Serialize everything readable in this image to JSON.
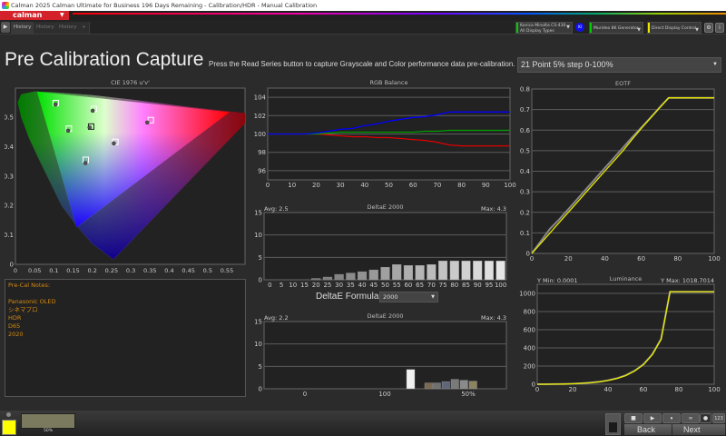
{
  "window": {
    "title": "Calman 2025 Calman Ultimate for Business 196 Days Remaining  - Calibration/HDR - Manual Calibration"
  },
  "logo": {
    "text": "calman"
  },
  "tabs": [
    {
      "label": "History 1",
      "active": true
    },
    {
      "label": "History 2"
    },
    {
      "label": "History 3"
    },
    {
      "label": "+"
    }
  ],
  "devices": {
    "meter": {
      "line1": "Konica Minolta CS-430",
      "line2": "All Display Types",
      "badge": "KI",
      "color": "#00cc00"
    },
    "generator": {
      "line1": "Murideo 8K Generator",
      "color": "#00cc00"
    },
    "display": {
      "line1": "Direct Display Control",
      "color": "#e8e800"
    }
  },
  "page": {
    "title": "Pre Calibration Capture",
    "instructions": "Press the Read Series button to capture Grayscale and Color performance data pre-calibration.",
    "series_select": "21 Point 5% step 0-100%"
  },
  "notes": {
    "text": "Pre-Cal Notes:\n\nPanasonic OLED\nシネマプロ\nHDR\nD65\n2020"
  },
  "deltae_formula": {
    "label": "DeltaE Formula",
    "value": "2000"
  },
  "bottom": {
    "preview_label": "50%",
    "back": "Back",
    "next": "Next",
    "counter": "123",
    "swatch_color": "#ffff00",
    "preview_color": "#7b7a5e"
  },
  "chart_data": [
    {
      "id": "cie",
      "type": "scatter",
      "title": "CIE 1976 u'v'",
      "xlim": [
        0,
        0.6
      ],
      "ylim": [
        0,
        0.6
      ],
      "xticks": [
        "0",
        "0.05",
        "0.1",
        "0.15",
        "0.2",
        "0.25",
        "0.3",
        "0.35",
        "0.4",
        "0.45",
        "0.5",
        "0.55"
      ],
      "yticks": [
        "0",
        "0.1",
        "0.2",
        "0.3",
        "0.4",
        "0.5"
      ],
      "gamut": {
        "red": [
          0.557,
          0.517
        ],
        "green": [
          0.056,
          0.587
        ],
        "blue": [
          0.159,
          0.126
        ]
      },
      "points": [
        {
          "name": "red",
          "target": [
            0.352,
            0.49
          ],
          "measured": [
            0.343,
            0.482
          ]
        },
        {
          "name": "green",
          "target": [
            0.105,
            0.548
          ],
          "measured": [
            0.104,
            0.543
          ]
        },
        {
          "name": "blue",
          "target": [
            0.183,
            0.355
          ],
          "measured": [
            0.182,
            0.344
          ]
        },
        {
          "name": "cyan",
          "target": [
            0.139,
            0.461
          ],
          "measured": [
            0.137,
            0.454
          ]
        },
        {
          "name": "magenta",
          "target": [
            0.26,
            0.416
          ],
          "measured": [
            0.256,
            0.411
          ]
        },
        {
          "name": "yellow",
          "target": [
            0.204,
            0.528
          ],
          "measured": [
            0.201,
            0.522
          ]
        },
        {
          "name": "white",
          "target": [
            0.197,
            0.468
          ],
          "measured": [
            0.193,
            0.465
          ]
        }
      ]
    },
    {
      "id": "rgb",
      "type": "line",
      "title": "RGB Balance",
      "xlim": [
        0,
        100
      ],
      "ylim": [
        95,
        105
      ],
      "xticks": [
        0,
        10,
        20,
        30,
        40,
        50,
        60,
        70,
        80,
        90,
        100
      ],
      "yticks": [
        96,
        98,
        100,
        102,
        104
      ],
      "x": [
        0,
        5,
        10,
        15,
        20,
        25,
        30,
        35,
        40,
        45,
        50,
        55,
        60,
        65,
        70,
        75,
        80,
        85,
        90,
        95,
        100
      ],
      "series": [
        {
          "color": "#e00000",
          "values": [
            100,
            100,
            100,
            100,
            100,
            99.9,
            99.8,
            99.7,
            99.7,
            99.6,
            99.6,
            99.5,
            99.4,
            99.3,
            99.1,
            98.8,
            98.7,
            98.7,
            98.7,
            98.7,
            98.7
          ]
        },
        {
          "color": "#00a000",
          "values": [
            100,
            100,
            100,
            100,
            100,
            100.1,
            100.2,
            100.2,
            100.2,
            100.2,
            100.2,
            100.2,
            100.2,
            100.3,
            100.3,
            100.4,
            100.4,
            100.4,
            100.4,
            100.4,
            100.4
          ]
        },
        {
          "color": "#0000ff",
          "values": [
            100,
            100,
            100,
            100,
            100.1,
            100.3,
            100.5,
            100.6,
            100.9,
            101.1,
            101.4,
            101.6,
            101.8,
            101.9,
            102.1,
            102.4,
            102.4,
            102.4,
            102.4,
            102.4,
            102.4
          ]
        }
      ]
    },
    {
      "id": "eotf",
      "type": "line",
      "title": "EOTF",
      "xlim": [
        0,
        100
      ],
      "ylim": [
        0,
        0.8
      ],
      "xticks": [
        0,
        20,
        40,
        60,
        80,
        100
      ],
      "yticks": [
        0,
        0.1,
        0.2,
        0.3,
        0.4,
        0.5,
        0.6,
        0.7,
        0.8
      ],
      "x": [
        0,
        5,
        10,
        15,
        20,
        25,
        30,
        35,
        40,
        45,
        50,
        55,
        60,
        65,
        70,
        75,
        80,
        85,
        90,
        95,
        100
      ],
      "series": [
        {
          "name": "target",
          "color": "#888888",
          "values": [
            0,
            0.06,
            0.12,
            0.165,
            0.215,
            0.265,
            0.315,
            0.365,
            0.415,
            0.465,
            0.515,
            0.565,
            0.612,
            0.66,
            0.71,
            0.757,
            0.757,
            0.757,
            0.757,
            0.757,
            0.757
          ]
        },
        {
          "name": "measured",
          "color": "#e8e800",
          "values": [
            0,
            0.05,
            0.1,
            0.15,
            0.2,
            0.25,
            0.3,
            0.35,
            0.4,
            0.45,
            0.5,
            0.555,
            0.608,
            0.658,
            0.708,
            0.757,
            0.757,
            0.757,
            0.757,
            0.757,
            0.757
          ]
        }
      ]
    },
    {
      "id": "lum",
      "type": "line",
      "title": "Luminance",
      "label_left": "Y Min: 0.0001",
      "label_right": "Y Max: 1018.7014",
      "xlim": [
        0,
        100
      ],
      "ylim": [
        0,
        1100
      ],
      "xticks": [
        0,
        20,
        40,
        60,
        80,
        100
      ],
      "yticks": [
        0,
        200,
        400,
        600,
        800,
        1000
      ],
      "x": [
        0,
        5,
        10,
        15,
        20,
        25,
        30,
        35,
        40,
        45,
        50,
        55,
        60,
        65,
        70,
        75,
        80,
        85,
        90,
        95,
        100
      ],
      "series": [
        {
          "name": "target",
          "color": "#888888",
          "values": [
            0,
            0.3,
            1,
            2.5,
            5,
            10,
            17,
            27,
            43,
            66,
            98,
            148,
            220,
            330,
            500,
            1018,
            1018,
            1018,
            1018,
            1018,
            1018
          ]
        },
        {
          "name": "measured",
          "color": "#e8e800",
          "values": [
            0,
            0.2,
            0.9,
            2.3,
            4.8,
            9.5,
            16,
            26,
            41,
            63,
            95,
            145,
            215,
            325,
            495,
            1018.7,
            1018.7,
            1018.7,
            1018.7,
            1018.7,
            1018.7
          ]
        }
      ]
    },
    {
      "id": "de1",
      "type": "bar",
      "title": "DeltaE 2000",
      "label_left": "Avg: 2.5",
      "label_right": "Max: 4.3",
      "ylim": [
        0,
        15
      ],
      "yticks": [
        0,
        5,
        10,
        15
      ],
      "categories": [
        "0",
        "5",
        "10",
        "15",
        "20",
        "25",
        "30",
        "35",
        "40",
        "45",
        "50",
        "55",
        "60",
        "65",
        "70",
        "75",
        "80",
        "85",
        "90",
        "95",
        "100"
      ],
      "values": [
        0,
        0,
        0,
        0,
        0.3,
        0.6,
        1.2,
        1.5,
        1.8,
        2.2,
        2.8,
        3.4,
        3.2,
        3.2,
        3.4,
        4.2,
        4.2,
        4.2,
        4.2,
        4.2,
        4.2
      ]
    },
    {
      "id": "de2",
      "type": "bar",
      "title": "DeltaE 2000",
      "label_left": "Avg: 2.2",
      "label_right": "Max: 4.3",
      "ylim": [
        0,
        15
      ],
      "yticks": [
        0,
        5,
        10,
        15
      ],
      "xticks": [
        "0",
        "100",
        "50%"
      ],
      "values": [
        4.3,
        1.3,
        1.3,
        1.6,
        2.1,
        1.9,
        1.7
      ],
      "colors": [
        "#f0f0f0",
        "#7a6a50",
        "#707070",
        "#5e6678",
        "#7a7a7a",
        "#8a8a8a",
        "#8a8460"
      ]
    }
  ]
}
